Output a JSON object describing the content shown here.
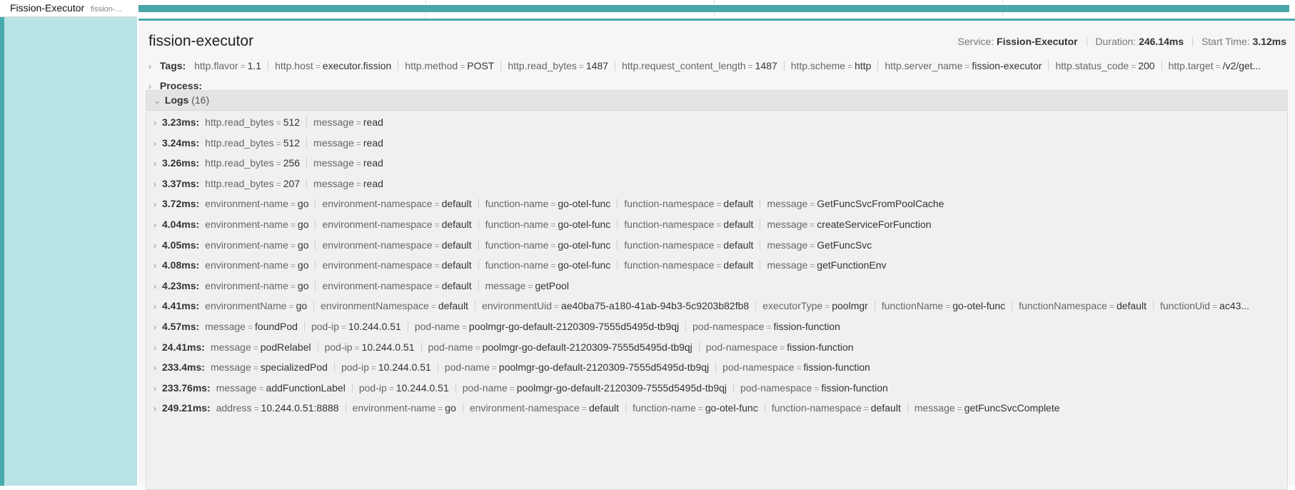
{
  "span_row": {
    "service": "Fission-Executor",
    "operation": "fission-..."
  },
  "detail": {
    "title": "fission-executor",
    "meta": {
      "service_label": "Service:",
      "service_value": "Fission-Executor",
      "duration_label": "Duration:",
      "duration_value": "246.14ms",
      "start_label": "Start Time:",
      "start_value": "3.12ms"
    },
    "tags_label": "Tags:",
    "tags": [
      {
        "key": "http.flavor",
        "value": "1.1"
      },
      {
        "key": "http.host",
        "value": "executor.fission"
      },
      {
        "key": "http.method",
        "value": "POST"
      },
      {
        "key": "http.read_bytes",
        "value": "1487"
      },
      {
        "key": "http.request_content_length",
        "value": "1487"
      },
      {
        "key": "http.scheme",
        "value": "http"
      },
      {
        "key": "http.server_name",
        "value": "fission-executor"
      },
      {
        "key": "http.status_code",
        "value": "200"
      },
      {
        "key": "http.target",
        "value": "/v2/get..."
      }
    ],
    "process_label": "Process:",
    "logs_label": "Logs",
    "logs_count": "(16)",
    "logs": [
      {
        "time": "3.23ms:",
        "fields": [
          {
            "key": "http.read_bytes",
            "value": "512"
          },
          {
            "key": "message",
            "value": "read"
          }
        ]
      },
      {
        "time": "3.24ms:",
        "fields": [
          {
            "key": "http.read_bytes",
            "value": "512"
          },
          {
            "key": "message",
            "value": "read"
          }
        ]
      },
      {
        "time": "3.26ms:",
        "fields": [
          {
            "key": "http.read_bytes",
            "value": "256"
          },
          {
            "key": "message",
            "value": "read"
          }
        ]
      },
      {
        "time": "3.37ms:",
        "fields": [
          {
            "key": "http.read_bytes",
            "value": "207"
          },
          {
            "key": "message",
            "value": "read"
          }
        ]
      },
      {
        "time": "3.72ms:",
        "fields": [
          {
            "key": "environment-name",
            "value": "go"
          },
          {
            "key": "environment-namespace",
            "value": "default"
          },
          {
            "key": "function-name",
            "value": "go-otel-func"
          },
          {
            "key": "function-namespace",
            "value": "default"
          },
          {
            "key": "message",
            "value": "GetFuncSvcFromPoolCache"
          }
        ]
      },
      {
        "time": "4.04ms:",
        "fields": [
          {
            "key": "environment-name",
            "value": "go"
          },
          {
            "key": "environment-namespace",
            "value": "default"
          },
          {
            "key": "function-name",
            "value": "go-otel-func"
          },
          {
            "key": "function-namespace",
            "value": "default"
          },
          {
            "key": "message",
            "value": "createServiceForFunction"
          }
        ]
      },
      {
        "time": "4.05ms:",
        "fields": [
          {
            "key": "environment-name",
            "value": "go"
          },
          {
            "key": "environment-namespace",
            "value": "default"
          },
          {
            "key": "function-name",
            "value": "go-otel-func"
          },
          {
            "key": "function-namespace",
            "value": "default"
          },
          {
            "key": "message",
            "value": "GetFuncSvc"
          }
        ]
      },
      {
        "time": "4.08ms:",
        "fields": [
          {
            "key": "environment-name",
            "value": "go"
          },
          {
            "key": "environment-namespace",
            "value": "default"
          },
          {
            "key": "function-name",
            "value": "go-otel-func"
          },
          {
            "key": "function-namespace",
            "value": "default"
          },
          {
            "key": "message",
            "value": "getFunctionEnv"
          }
        ]
      },
      {
        "time": "4.23ms:",
        "fields": [
          {
            "key": "environment-name",
            "value": "go"
          },
          {
            "key": "environment-namespace",
            "value": "default"
          },
          {
            "key": "message",
            "value": "getPool"
          }
        ]
      },
      {
        "time": "4.41ms:",
        "fields": [
          {
            "key": "environmentName",
            "value": "go"
          },
          {
            "key": "environmentNamespace",
            "value": "default"
          },
          {
            "key": "environmentUid",
            "value": "ae40ba75-a180-41ab-94b3-5c9203b82fb8"
          },
          {
            "key": "executorType",
            "value": "poolmgr"
          },
          {
            "key": "functionName",
            "value": "go-otel-func"
          },
          {
            "key": "functionNamespace",
            "value": "default"
          },
          {
            "key": "functionUid",
            "value": "ac43..."
          }
        ]
      },
      {
        "time": "4.57ms:",
        "fields": [
          {
            "key": "message",
            "value": "foundPod"
          },
          {
            "key": "pod-ip",
            "value": "10.244.0.51"
          },
          {
            "key": "pod-name",
            "value": "poolmgr-go-default-2120309-7555d5495d-tb9qj"
          },
          {
            "key": "pod-namespace",
            "value": "fission-function"
          }
        ]
      },
      {
        "time": "24.41ms:",
        "fields": [
          {
            "key": "message",
            "value": "podRelabel"
          },
          {
            "key": "pod-ip",
            "value": "10.244.0.51"
          },
          {
            "key": "pod-name",
            "value": "poolmgr-go-default-2120309-7555d5495d-tb9qj"
          },
          {
            "key": "pod-namespace",
            "value": "fission-function"
          }
        ]
      },
      {
        "time": "233.4ms:",
        "fields": [
          {
            "key": "message",
            "value": "specializedPod"
          },
          {
            "key": "pod-ip",
            "value": "10.244.0.51"
          },
          {
            "key": "pod-name",
            "value": "poolmgr-go-default-2120309-7555d5495d-tb9qj"
          },
          {
            "key": "pod-namespace",
            "value": "fission-function"
          }
        ]
      },
      {
        "time": "233.76ms:",
        "fields": [
          {
            "key": "message",
            "value": "addFunctionLabel"
          },
          {
            "key": "pod-ip",
            "value": "10.244.0.51"
          },
          {
            "key": "pod-name",
            "value": "poolmgr-go-default-2120309-7555d5495d-tb9qj"
          },
          {
            "key": "pod-namespace",
            "value": "fission-function"
          }
        ]
      },
      {
        "time": "249.21ms:",
        "fields": [
          {
            "key": "address",
            "value": "10.244.0.51:8888"
          },
          {
            "key": "environment-name",
            "value": "go"
          },
          {
            "key": "environment-namespace",
            "value": "default"
          },
          {
            "key": "function-name",
            "value": "go-otel-func"
          },
          {
            "key": "function-namespace",
            "value": "default"
          },
          {
            "key": "message",
            "value": "getFuncSvcComplete"
          }
        ]
      }
    ]
  }
}
